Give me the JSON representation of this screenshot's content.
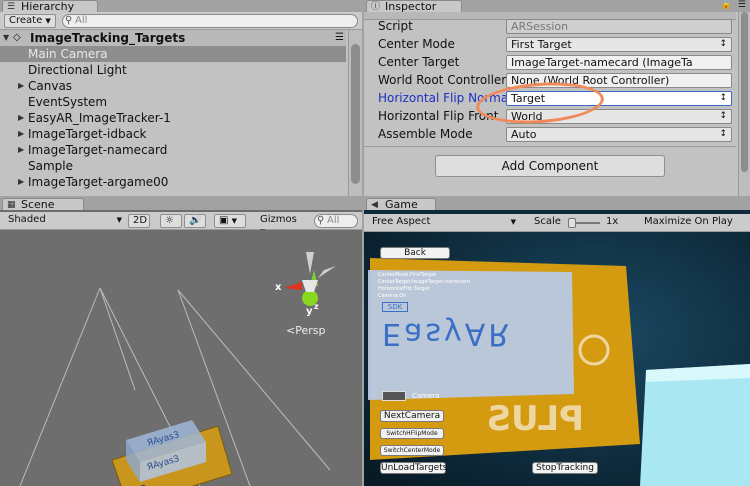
{
  "hierarchy": {
    "tab_label": "Hierarchy",
    "create_label": "Create",
    "search_placeholder": "All",
    "scene_name": "ImageTracking_Targets",
    "items": [
      {
        "label": "Main Camera",
        "selected": true
      },
      {
        "label": "Directional Light"
      },
      {
        "label": "Canvas",
        "expandable": true
      },
      {
        "label": "EventSystem"
      },
      {
        "label": "EasyAR_ImageTracker-1",
        "expandable": true
      },
      {
        "label": "ImageTarget-idback",
        "expandable": true
      },
      {
        "label": "ImageTarget-namecard",
        "expandable": true
      },
      {
        "label": "Sample"
      },
      {
        "label": "ImageTarget-argame00",
        "expandable": true
      }
    ]
  },
  "inspector": {
    "tab_label": "Inspector",
    "rows": [
      {
        "label": "Script",
        "value": "ARSession",
        "kind": "object-disabled"
      },
      {
        "label": "Center Mode",
        "value": "First Target",
        "kind": "dropdown"
      },
      {
        "label": "Center Target",
        "value": "ImageTarget-namecard (ImageTa",
        "kind": "object"
      },
      {
        "label": "World Root Controller",
        "value": "None (World Root Controller)",
        "kind": "object"
      },
      {
        "label": "Horizontal Flip Normal",
        "value": "Target",
        "kind": "dropdown",
        "highlight": true
      },
      {
        "label": "Horizontal Flip Front",
        "value": "World",
        "kind": "dropdown"
      },
      {
        "label": "Assemble Mode",
        "value": "Auto",
        "kind": "dropdown"
      }
    ],
    "add_component_label": "Add Component"
  },
  "scene": {
    "tab_label": "Scene",
    "shading_label": "Shaded",
    "mode_2d_label": "2D",
    "gizmos_label": "Gizmos",
    "search_placeholder": "All",
    "persp_label": "Persp",
    "axis_x": "x",
    "axis_y": "y",
    "axis_z": "z"
  },
  "game": {
    "tab_label": "Game",
    "aspect_label": "Free Aspect",
    "scale_label": "Scale",
    "scale_value": "1x",
    "maximize_label": "Maximize On Play",
    "buttons": {
      "back": "Back",
      "next_camera": "NextCamera",
      "switch_hflip": "SwitchHFlipMode",
      "switch_center": "SwitchCenterMode",
      "unload_targets": "UnLoadTargets",
      "stop_tracking": "StopTracking"
    },
    "camera_label": "Camera",
    "info_lines": [
      "CenterMode:FirstTarget",
      "CenterTarget:ImageTarget-namecard",
      "HorizontalFlip:Target",
      "Camera:On"
    ],
    "sdk_label": "SDK",
    "card_brand": "EasyAR",
    "card_plus": "PLUS"
  },
  "colors": {
    "highlight_ring": "#f08a5b",
    "sky": "#0f2a3a",
    "card": "#d49a10"
  }
}
